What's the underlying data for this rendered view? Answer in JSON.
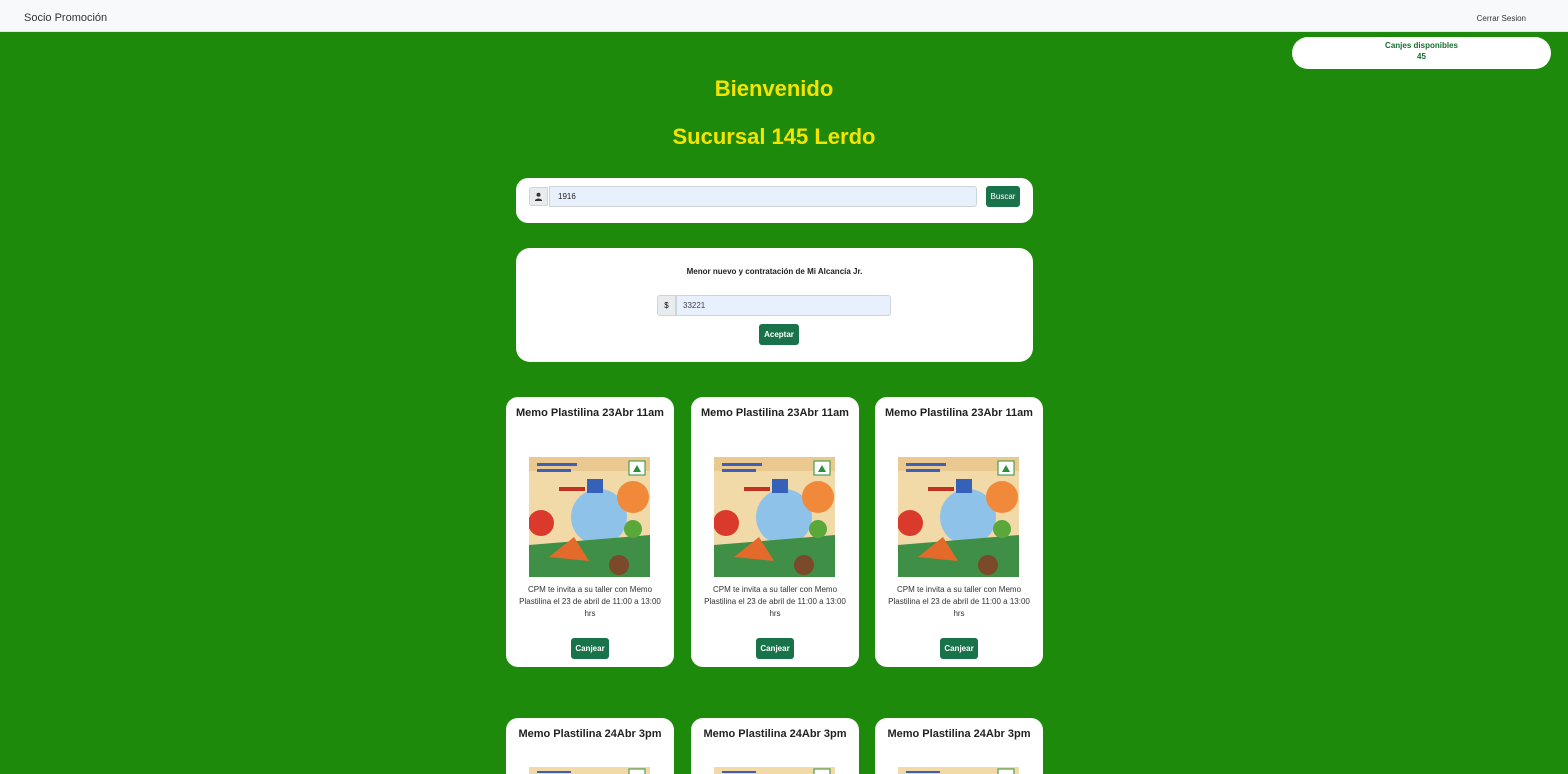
{
  "navbar": {
    "brand": "Socio Promoción",
    "logout": "Cerrar Sesion"
  },
  "canjes": {
    "label": "Canjes disponibles",
    "value": "45"
  },
  "welcome": {
    "title": "Bienvenido",
    "branch": "Sucursal 145 Lerdo"
  },
  "search": {
    "value": "1916",
    "button": "Buscar"
  },
  "promo": {
    "title": "Menor nuevo y contratación de Mi Alcancía Jr.",
    "currency": "$",
    "amount": "33221",
    "button": "Aceptar"
  },
  "events": [
    {
      "title": "Memo Plastilina 23Abr 11am",
      "description": "CPM te invita a su taller con Memo Plastilina el 23 de abril de 11:00 a 13:00 hrs",
      "button": "Canjear"
    },
    {
      "title": "Memo Plastilina 23Abr 11am",
      "description": "CPM te invita a su taller con Memo Plastilina el 23 de abril de 11:00 a 13:00 hrs",
      "button": "Canjear"
    },
    {
      "title": "Memo Plastilina 23Abr 11am",
      "description": "CPM te invita a su taller con Memo Plastilina el 23 de abril de 11:00 a 13:00 hrs",
      "button": "Canjear"
    },
    {
      "title": "Memo Plastilina 24Abr 3pm"
    },
    {
      "title": "Memo Plastilina 24Abr 3pm"
    },
    {
      "title": "Memo Plastilina 24Abr 3pm"
    }
  ],
  "colors": {
    "background": "#1e8a0b",
    "accent": "#f7e300",
    "button": "#19734a"
  },
  "icons": {
    "user": "user-icon"
  }
}
